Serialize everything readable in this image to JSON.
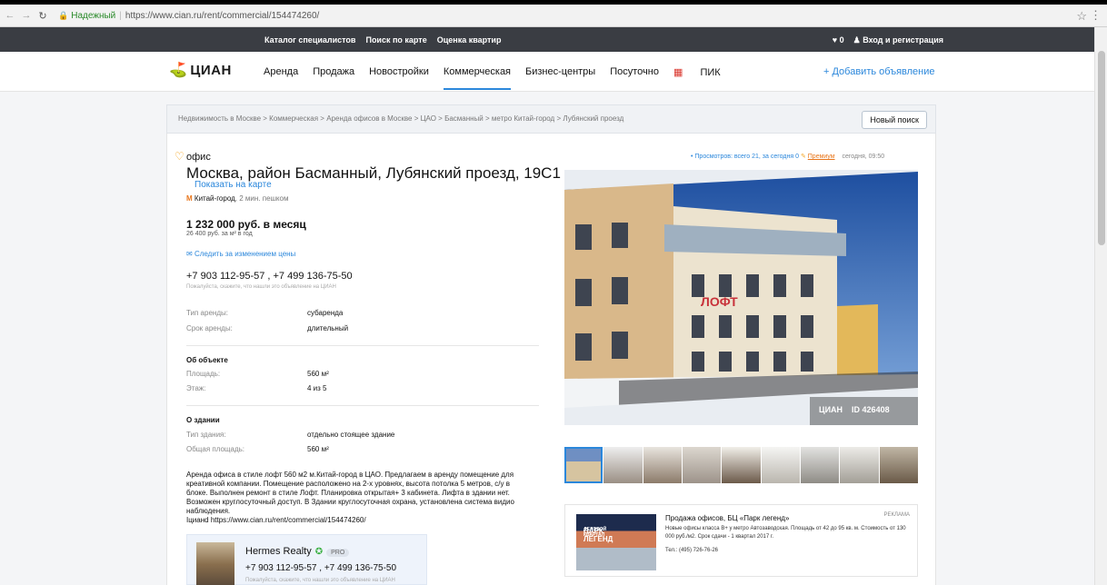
{
  "browser": {
    "secure_label": "Надежный",
    "url": "https://www.cian.ru/rent/commercial/154474260/"
  },
  "topbar": {
    "links": [
      "Каталог специалистов",
      "Поиск по карте",
      "Оценка квартир"
    ],
    "fav_count": "0",
    "login": "Вход и регистрация"
  },
  "nav": {
    "logo": "ЦИАН",
    "items": [
      "Аренда",
      "Продажа",
      "Новостройки",
      "Коммерческая",
      "Бизнес-центры",
      "Посуточно",
      "ПИК"
    ],
    "active": "Коммерческая",
    "add": "+ Добавить объявление"
  },
  "breadcrumbs": [
    "Недвижимость в Москве",
    "Коммерческая",
    "Аренда офисов в Москве",
    "ЦАО",
    "Басманный",
    "метро Китай-город",
    "Лубянский проезд"
  ],
  "new_search": "Новый поиск",
  "listing": {
    "type": "офис",
    "address": "Москва, район Басманный, Лубянский проезд, 19С1",
    "map_link": "Показать на карте",
    "metro": "Китай-город",
    "metro_time": ", 2 мин. пешком",
    "price": "1 232 000 руб. в месяц",
    "price_m2": "26 400 руб. за м² в год",
    "follow_price": "Следить за изменением цены",
    "phones": "+7 903 112-95-57 , +7 499 136-75-50",
    "phone_hint": "Пожалуйста, скажите, что нашли это объявление на ЦИАН",
    "rent": [
      {
        "k": "Тип аренды:",
        "v": "субаренда"
      },
      {
        "k": "Срок аренды:",
        "v": "длительный"
      }
    ],
    "object_title": "Об объекте",
    "object": [
      {
        "k": "Площадь:",
        "v": "560 м²"
      },
      {
        "k": "Этаж:",
        "v": "4 из 5"
      }
    ],
    "building_title": "О здании",
    "building": [
      {
        "k": "Тип здания:",
        "v": "отдельно стоящее здание"
      },
      {
        "k": "Общая площадь:",
        "v": "560 м²"
      }
    ],
    "description": "Аренда офиса в стиле лофт 560 м2 м.Китай-город в ЦАО. Предлагаем в аренду помещение для креативной компании. Помещение расположено на 2-х уровнях, высота потолка 5 метров, с/у в блоке. Выполнен ремонт в стиле Лофт. Планировка открытая+ 3 кабинета. Лифта в здании нет. Возможен круглосуточный доступ. В Здании круглосуточная охрана, установлена система видио наблюдения.",
    "description_link": "Iцианd https://www.cian.ru/rent/commercial/154474260/"
  },
  "agent": {
    "name": "Hermes Realty",
    "badge": "PRO",
    "phones": "+7 903 112-95-57 , +7 499 136-75-50",
    "hint": "Пожалуйста, скажите, что нашли это объявление на ЦИАН"
  },
  "stats": {
    "views": "• Просмотров: всего 21, за сегодня 0",
    "premium": "Премиум",
    "time": "сегодня, 09:50"
  },
  "photo": {
    "watermark_logo": "ЦИАН",
    "watermark_id": "ID 426408",
    "sign": "ЛОФТ"
  },
  "ad": {
    "logo_text": "ПАРК ЛЕГЕНД",
    "logo_sub": "ДЕЛОВОЙ КВАРТАЛ",
    "label": "РЕКЛАМА",
    "title": "Продажа офисов, БЦ «Парк легенд»",
    "text": "Новые офисы класса В+ у метро Автозаводская. Площадь от 42 до 95 кв. м. Стоимость от 130 000 руб./м2. Срок сдачи - 1 квартал 2017 г.",
    "tel": "Тел.: (495) 726-76-26"
  }
}
